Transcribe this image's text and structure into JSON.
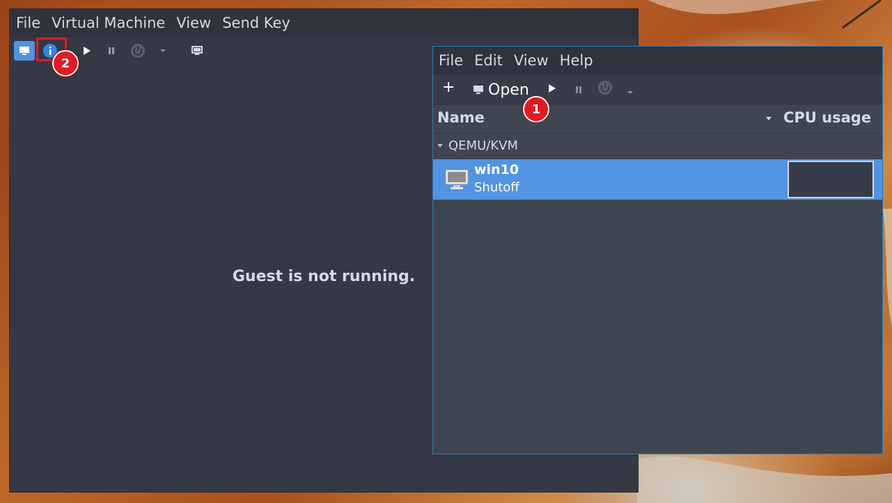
{
  "console": {
    "menus": [
      "File",
      "Virtual Machine",
      "View",
      "Send Key"
    ],
    "guest_message": "Guest is not running.",
    "toolbar_icons": [
      "monitor-icon",
      "info-icon",
      "play-icon",
      "pause-icon",
      "power-icon",
      "chevron-down-icon",
      "screenshot-icon"
    ]
  },
  "manager": {
    "menus": [
      "File",
      "Edit",
      "View",
      "Help"
    ],
    "toolbar": {
      "new_label": "+",
      "open_label": "Open"
    },
    "columns": {
      "name": "Name",
      "cpu": "CPU usage"
    },
    "group": {
      "label": "QEMU/KVM"
    },
    "vm": {
      "name": "win10",
      "state": "Shutoff"
    }
  },
  "annotations": {
    "step1": "1",
    "step2": "2"
  },
  "colors": {
    "window_bg": "#353945",
    "menubar_bg": "#2f333d",
    "selection": "#5294e2",
    "highlight": "#e01b24",
    "text": "#d3dae3"
  }
}
